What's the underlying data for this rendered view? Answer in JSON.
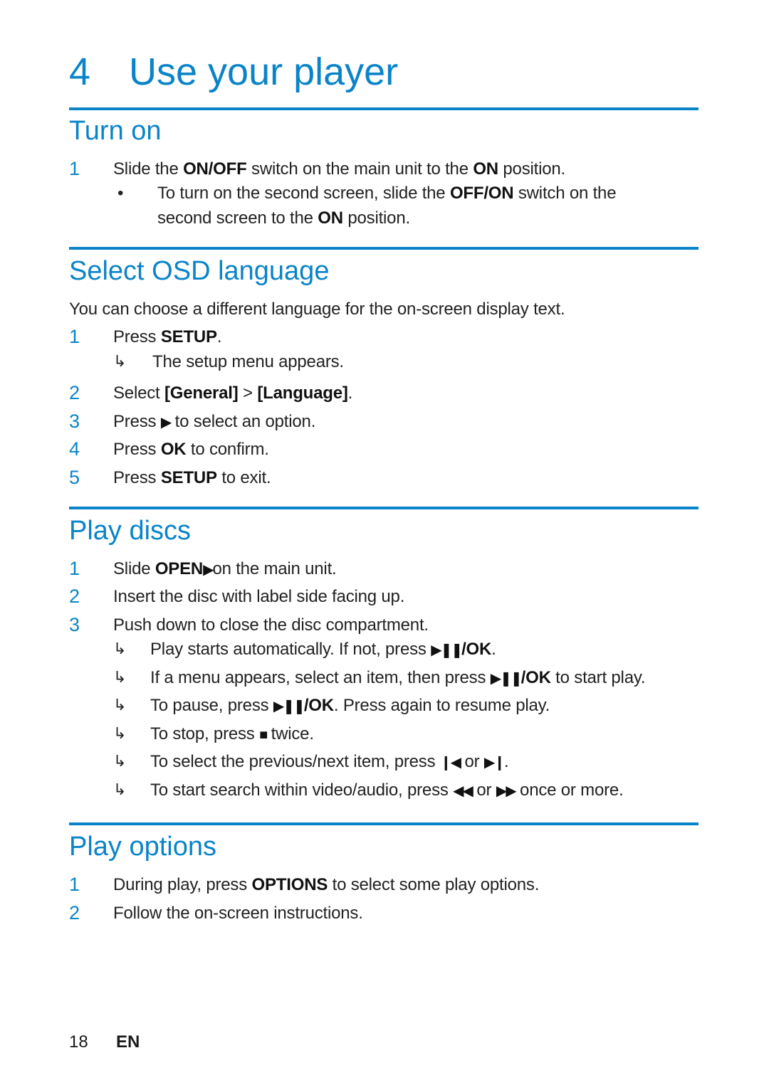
{
  "chapter": {
    "number": "4",
    "title": "Use your player"
  },
  "accent_color": "#0a84c8",
  "sections": {
    "turn_on": {
      "heading": "Turn on",
      "steps": [
        {
          "num": "1",
          "parts": [
            "Slide the ",
            "ON/OFF",
            " switch on the main unit to the ",
            "ON",
            " position."
          ]
        }
      ],
      "bullet": {
        "glyph": "•",
        "line1": [
          "To turn on the second screen, slide the ",
          "OFF/ON",
          " switch on the"
        ],
        "line2": [
          "second screen to the ",
          "ON",
          " position."
        ]
      }
    },
    "osd": {
      "heading": "Select OSD language",
      "intro": "You can choose a different language for the on-screen display text.",
      "steps": [
        {
          "num": "1",
          "pre": "Press ",
          "bold": "SETUP",
          "post": "."
        },
        {
          "num": "2",
          "pre": "Select ",
          "bold1": "[General]",
          "mid": " > ",
          "bold2": "[Language]",
          "post": "."
        },
        {
          "num": "3",
          "pre": "Press ",
          "icon": "play-icon",
          "post": " to select an option."
        },
        {
          "num": "4",
          "pre": "Press ",
          "bold": "OK",
          "post": " to confirm."
        },
        {
          "num": "5",
          "pre": "Press ",
          "bold": "SETUP",
          "post": " to exit."
        }
      ],
      "result_1": "The setup menu appears."
    },
    "play_discs": {
      "heading": "Play discs",
      "steps": [
        {
          "num": "1",
          "pre": "Slide ",
          "bold": "OPEN",
          "icon": "play-icon",
          "post": "on the main unit."
        },
        {
          "num": "2",
          "text": "Insert the disc with label side facing up."
        },
        {
          "num": "3",
          "text": "Push down to close the disc compartment."
        }
      ],
      "results": [
        {
          "pre": "Play starts automatically. If not, press ",
          "icon": "play-pause-icon",
          "bold": "/OK",
          "post": "."
        },
        {
          "pre": "If a menu appears, select an item, then press ",
          "icon": "play-pause-icon",
          "bold": "/OK",
          "post": " to start play."
        },
        {
          "pre": "To pause, press ",
          "icon": "play-pause-icon",
          "bold": "/OK",
          "post": ". Press again to resume play."
        },
        {
          "pre": "To stop, press ",
          "icon": "stop-icon",
          "post": " twice."
        },
        {
          "pre": "To select the previous/next item, press ",
          "icon1": "previous-icon",
          "mid": " or ",
          "icon2": "next-icon",
          "post": "."
        },
        {
          "pre": "To start search within video/audio, press ",
          "icon1": "rewind-icon",
          "mid": " or ",
          "icon2": "fast-forward-icon",
          "post": " once or more."
        }
      ]
    },
    "play_options": {
      "heading": "Play options",
      "steps": [
        {
          "num": "1",
          "pre": "During play, press ",
          "bold": "OPTIONS",
          "post": " to select some play options."
        },
        {
          "num": "2",
          "text": "Follow the on-screen instructions."
        }
      ]
    }
  },
  "result_arrow": "↳",
  "footer": {
    "page": "18",
    "lang": "EN"
  }
}
